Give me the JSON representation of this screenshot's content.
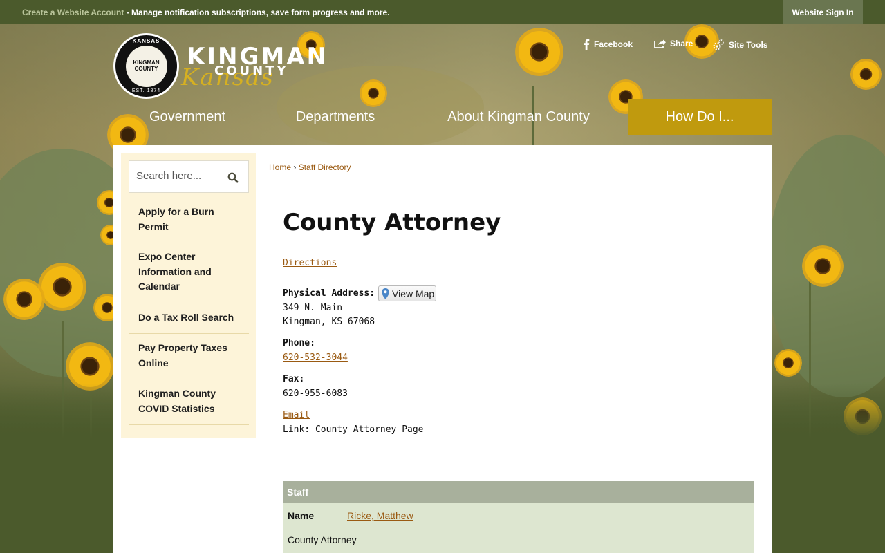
{
  "topbar": {
    "create_account": "Create a Website Account",
    "message": " - Manage notification subscriptions, save form progress and more.",
    "sign_in": "Website Sign In"
  },
  "logo": {
    "seal_top": "KANSAS",
    "seal_center_line1": "KINGMAN",
    "seal_center_line2": "COUNTY",
    "seal_bottom": "EST. 1874",
    "line1": "KINGMAN",
    "line2": "COUNTY",
    "line3": "Kansas"
  },
  "social": {
    "facebook": "Facebook",
    "share": "Share",
    "site_tools": "Site Tools"
  },
  "nav": {
    "items": [
      "Government",
      "Departments",
      "About Kingman County",
      "How Do I..."
    ],
    "active_index": 3
  },
  "sidebar": {
    "search_placeholder": "Search here...",
    "links": [
      "Apply for a Burn Permit",
      "Expo Center Information and Calendar",
      "Do a Tax Roll Search",
      "Pay Property Taxes Online",
      "Kingman County COVID Statistics"
    ]
  },
  "breadcrumb": {
    "home": "Home",
    "separator": "›",
    "current": "Staff Directory"
  },
  "page": {
    "title": "County Attorney",
    "directions": "Directions",
    "physical_address_label": "Physical Address:",
    "view_map": "View Map",
    "address_line1": "349 N. Main",
    "address_line2": "Kingman, KS 67068",
    "phone_label": "Phone:",
    "phone": "620-532-3044",
    "fax_label": "Fax:",
    "fax": "620-955-6083",
    "email": "Email",
    "link_label": "Link:",
    "link_text": "County Attorney Page"
  },
  "staff": {
    "header": "Staff",
    "name_label": "Name",
    "name": "Ricke, Matthew",
    "position": "County Attorney"
  },
  "colors": {
    "olive": "#4b5a2c",
    "gold": "#c09a0e",
    "link": "#9a5a12",
    "sidebar_bg": "#fdf4d9",
    "staff_header": "#a8b09c",
    "staff_body": "#dde6d0"
  }
}
